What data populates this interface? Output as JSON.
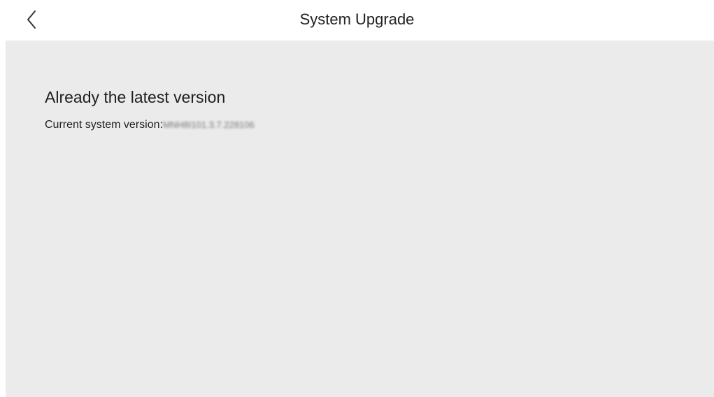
{
  "header": {
    "title": "System Upgrade",
    "back_icon": "chevron-left-icon"
  },
  "status": {
    "title": "Already the latest version",
    "version_label": "Current system version:",
    "version_value": "MNH8I101.3.7.228106"
  },
  "colors": {
    "header_bg": "#ffffff",
    "content_bg": "#ebebeb",
    "text": "#1f1f1f"
  }
}
